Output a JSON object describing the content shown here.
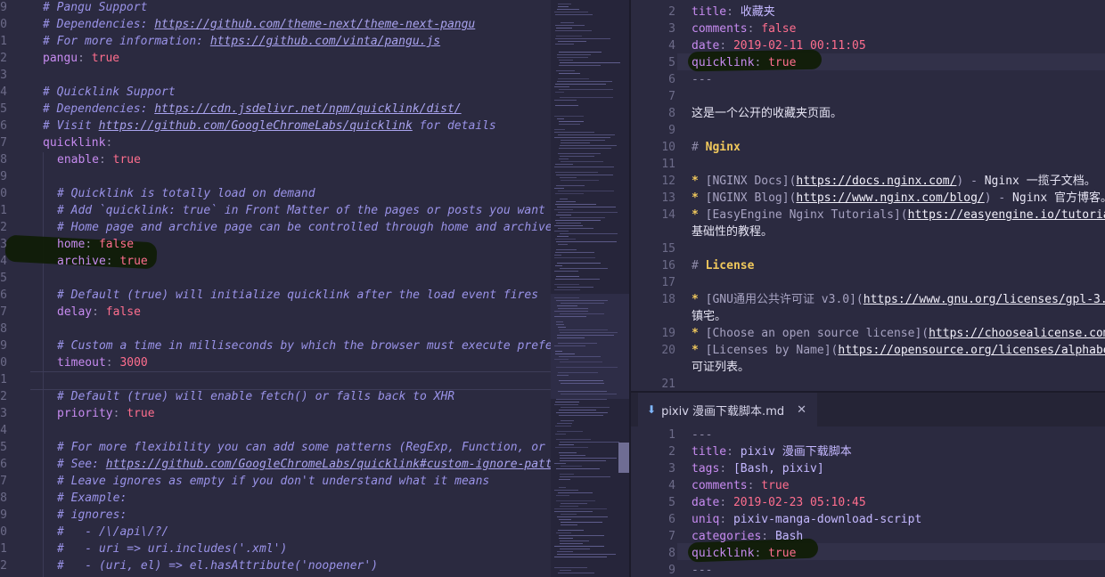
{
  "left_editor": {
    "lines": [
      {
        "num": "9",
        "indent": 0,
        "tokens": [
          {
            "t": "# Pangu Support",
            "c": "c"
          }
        ]
      },
      {
        "num": "0",
        "indent": 0,
        "tokens": [
          {
            "t": "# Dependencies: ",
            "c": "c"
          },
          {
            "t": "https://github.com/theme-next/theme-next-pangu",
            "c": "u"
          }
        ]
      },
      {
        "num": "1",
        "indent": 0,
        "tokens": [
          {
            "t": "# For more information: ",
            "c": "c"
          },
          {
            "t": "https://github.com/vinta/pangu.js",
            "c": "u"
          }
        ]
      },
      {
        "num": "2",
        "indent": 0,
        "tokens": [
          {
            "t": "pangu",
            "c": "k"
          },
          {
            "t": ": ",
            "c": "p"
          },
          {
            "t": "true",
            "c": "b"
          }
        ]
      },
      {
        "num": "3",
        "indent": 0,
        "tokens": []
      },
      {
        "num": "4",
        "indent": 0,
        "tokens": [
          {
            "t": "# Quicklink Support",
            "c": "c"
          }
        ]
      },
      {
        "num": "5",
        "indent": 0,
        "tokens": [
          {
            "t": "# Dependencies: ",
            "c": "c"
          },
          {
            "t": "https://cdn.jsdelivr.net/npm/quicklink/dist/",
            "c": "u"
          }
        ]
      },
      {
        "num": "6",
        "indent": 0,
        "tokens": [
          {
            "t": "# Visit ",
            "c": "c"
          },
          {
            "t": "https://github.com/GoogleChromeLabs/quicklink",
            "c": "u"
          },
          {
            "t": " for details",
            "c": "c"
          }
        ]
      },
      {
        "num": "7",
        "indent": 0,
        "tokens": [
          {
            "t": "quicklink",
            "c": "k"
          },
          {
            "t": ":",
            "c": "p"
          }
        ]
      },
      {
        "num": "8",
        "indent": 1,
        "tokens": [
          {
            "t": "enable",
            "c": "k"
          },
          {
            "t": ": ",
            "c": "p"
          },
          {
            "t": "true",
            "c": "b"
          }
        ]
      },
      {
        "num": "9",
        "indent": 1,
        "tokens": []
      },
      {
        "num": "0",
        "indent": 1,
        "tokens": [
          {
            "t": "# Quicklink is totally load on demand",
            "c": "c"
          }
        ]
      },
      {
        "num": "1",
        "indent": 1,
        "tokens": [
          {
            "t": "# Add `quicklink: true` in Front Matter of the pages or posts you want",
            "c": "c"
          }
        ]
      },
      {
        "num": "2",
        "indent": 1,
        "tokens": [
          {
            "t": "# Home page and archive page can be controlled through home and archive",
            "c": "c"
          }
        ]
      },
      {
        "num": "3",
        "indent": 1,
        "tokens": [
          {
            "t": "home",
            "c": "k"
          },
          {
            "t": ": ",
            "c": "p"
          },
          {
            "t": "false",
            "c": "b"
          }
        ]
      },
      {
        "num": "4",
        "indent": 1,
        "tokens": [
          {
            "t": "archive",
            "c": "k"
          },
          {
            "t": ": ",
            "c": "p"
          },
          {
            "t": "true",
            "c": "b"
          }
        ]
      },
      {
        "num": "5",
        "indent": 1,
        "tokens": []
      },
      {
        "num": "6",
        "indent": 1,
        "tokens": [
          {
            "t": "# Default (true) will initialize quicklink after the load event fires",
            "c": "c"
          }
        ]
      },
      {
        "num": "7",
        "indent": 1,
        "tokens": [
          {
            "t": "delay",
            "c": "k"
          },
          {
            "t": ": ",
            "c": "p"
          },
          {
            "t": "false",
            "c": "b"
          }
        ]
      },
      {
        "num": "8",
        "indent": 1,
        "tokens": []
      },
      {
        "num": "9",
        "indent": 1,
        "tokens": [
          {
            "t": "# Custom a time in milliseconds by which the browser must execute prefet",
            "c": "c"
          }
        ]
      },
      {
        "num": "0",
        "indent": 1,
        "tokens": [
          {
            "t": "timeout",
            "c": "k"
          },
          {
            "t": ": ",
            "c": "p"
          },
          {
            "t": "3000",
            "c": "n"
          }
        ]
      },
      {
        "num": "1",
        "indent": 1,
        "tokens": []
      },
      {
        "num": "2",
        "indent": 1,
        "tokens": [
          {
            "t": "# Default (true) will enable fetch() or falls back to XHR",
            "c": "c"
          }
        ]
      },
      {
        "num": "3",
        "indent": 1,
        "tokens": [
          {
            "t": "priority",
            "c": "k"
          },
          {
            "t": ": ",
            "c": "p"
          },
          {
            "t": "true",
            "c": "b"
          }
        ]
      },
      {
        "num": "4",
        "indent": 1,
        "tokens": []
      },
      {
        "num": "5",
        "indent": 1,
        "tokens": [
          {
            "t": "# For more flexibility you can add some patterns (RegExp, Function, or A",
            "c": "c"
          }
        ]
      },
      {
        "num": "6",
        "indent": 1,
        "tokens": [
          {
            "t": "# See: ",
            "c": "c"
          },
          {
            "t": "https://github.com/GoogleChromeLabs/quicklink#custom-ignore-patte",
            "c": "u"
          }
        ]
      },
      {
        "num": "7",
        "indent": 1,
        "tokens": [
          {
            "t": "# Leave ignores as empty if you don't understand what it means",
            "c": "c"
          }
        ]
      },
      {
        "num": "8",
        "indent": 1,
        "tokens": [
          {
            "t": "# Example:",
            "c": "c"
          }
        ]
      },
      {
        "num": "9",
        "indent": 1,
        "tokens": [
          {
            "t": "# ignores:",
            "c": "c"
          }
        ]
      },
      {
        "num": "0",
        "indent": 1,
        "tokens": [
          {
            "t": "#   - /\\/api\\/?/",
            "c": "c"
          }
        ]
      },
      {
        "num": "1",
        "indent": 1,
        "tokens": [
          {
            "t": "#   - uri => uri.includes('.xml')",
            "c": "c"
          }
        ]
      },
      {
        "num": "2",
        "indent": 1,
        "tokens": [
          {
            "t": "#   - (uri, el) => el.hasAttribute('noopener')",
            "c": "c"
          }
        ]
      }
    ]
  },
  "right_top_editor": {
    "lines": [
      {
        "num": "2",
        "tokens": [
          {
            "t": "title",
            "c": "k"
          },
          {
            "t": ": ",
            "c": "p"
          },
          {
            "t": "收藏夹",
            "c": "s"
          }
        ]
      },
      {
        "num": "3",
        "tokens": [
          {
            "t": "comments",
            "c": "k"
          },
          {
            "t": ": ",
            "c": "p"
          },
          {
            "t": "false",
            "c": "b"
          }
        ]
      },
      {
        "num": "4",
        "tokens": [
          {
            "t": "date",
            "c": "k"
          },
          {
            "t": ": ",
            "c": "p"
          },
          {
            "t": "2019-02-11 00:11:05",
            "c": "n"
          }
        ]
      },
      {
        "num": "5",
        "tokens": [
          {
            "t": "quicklink",
            "c": "k"
          },
          {
            "t": ": ",
            "c": "p"
          },
          {
            "t": "true",
            "c": "b"
          }
        ]
      },
      {
        "num": "6",
        "tokens": [
          {
            "t": "---",
            "c": "p"
          }
        ]
      },
      {
        "num": "7",
        "tokens": []
      },
      {
        "num": "8",
        "tokens": [
          {
            "t": "这是一个公开的收藏夹页面。",
            "c": "t"
          }
        ]
      },
      {
        "num": "9",
        "tokens": []
      },
      {
        "num": "10",
        "tokens": [
          {
            "t": "# ",
            "c": "p"
          },
          {
            "t": "Nginx",
            "c": "h"
          }
        ]
      },
      {
        "num": "11",
        "tokens": []
      },
      {
        "num": "12",
        "tokens": [
          {
            "t": "* ",
            "c": "h"
          },
          {
            "t": "[NGINX Docs](",
            "c": "d"
          },
          {
            "t": "https://docs.nginx.com/",
            "c": "lk"
          },
          {
            "t": ") - ",
            "c": "d"
          },
          {
            "t": "Nginx 一揽子文档。",
            "c": "t"
          }
        ]
      },
      {
        "num": "13",
        "tokens": [
          {
            "t": "* ",
            "c": "h"
          },
          {
            "t": "[NGINX Blog](",
            "c": "d"
          },
          {
            "t": "https://www.nginx.com/blog/",
            "c": "lk"
          },
          {
            "t": ") - ",
            "c": "d"
          },
          {
            "t": "Nginx 官方博客。",
            "c": "t"
          }
        ]
      },
      {
        "num": "14",
        "tokens": [
          {
            "t": "* ",
            "c": "h"
          },
          {
            "t": "[EasyEngine Nginx Tutorials](",
            "c": "d"
          },
          {
            "t": "https://easyengine.io/tutoria",
            "c": "lk"
          }
        ]
      },
      {
        "num": "",
        "tokens": [
          {
            "t": "基础性的教程。",
            "c": "t"
          }
        ]
      },
      {
        "num": "15",
        "tokens": []
      },
      {
        "num": "16",
        "tokens": [
          {
            "t": "# ",
            "c": "p"
          },
          {
            "t": "License",
            "c": "h"
          }
        ]
      },
      {
        "num": "17",
        "tokens": []
      },
      {
        "num": "18",
        "tokens": [
          {
            "t": "* ",
            "c": "h"
          },
          {
            "t": "[GNU通用公共许可证 v3.0](",
            "c": "d"
          },
          {
            "t": "https://www.gnu.org/licenses/gpl-3.",
            "c": "lk"
          }
        ]
      },
      {
        "num": "",
        "tokens": [
          {
            "t": "镇宅。",
            "c": "t"
          }
        ]
      },
      {
        "num": "19",
        "tokens": [
          {
            "t": "* ",
            "c": "h"
          },
          {
            "t": "[Choose an open source license](",
            "c": "d"
          },
          {
            "t": "https://choosealicense.com",
            "c": "lk"
          }
        ]
      },
      {
        "num": "20",
        "tokens": [
          {
            "t": "* ",
            "c": "h"
          },
          {
            "t": "[Licenses by Name](",
            "c": "d"
          },
          {
            "t": "https://opensource.org/licenses/alphabe",
            "c": "lk"
          }
        ]
      },
      {
        "num": "",
        "tokens": [
          {
            "t": "可证列表。",
            "c": "t"
          }
        ]
      },
      {
        "num": "21",
        "tokens": []
      }
    ]
  },
  "tab": {
    "label": "pixiv 漫画下载脚本.md",
    "icon": "arrow-down-icon",
    "close": "✕"
  },
  "right_bottom_editor": {
    "lines": [
      {
        "num": "1",
        "tokens": [
          {
            "t": "---",
            "c": "p"
          }
        ]
      },
      {
        "num": "2",
        "tokens": [
          {
            "t": "title",
            "c": "k"
          },
          {
            "t": ": ",
            "c": "p"
          },
          {
            "t": "pixiv 漫画下载脚本",
            "c": "s"
          }
        ]
      },
      {
        "num": "3",
        "tokens": [
          {
            "t": "tags",
            "c": "k"
          },
          {
            "t": ": ",
            "c": "p"
          },
          {
            "t": "[Bash, pixiv]",
            "c": "s"
          }
        ]
      },
      {
        "num": "4",
        "tokens": [
          {
            "t": "comments",
            "c": "k"
          },
          {
            "t": ": ",
            "c": "p"
          },
          {
            "t": "true",
            "c": "b"
          }
        ]
      },
      {
        "num": "5",
        "tokens": [
          {
            "t": "date",
            "c": "k"
          },
          {
            "t": ": ",
            "c": "p"
          },
          {
            "t": "2019-02-23 05:10:45",
            "c": "n"
          }
        ]
      },
      {
        "num": "6",
        "tokens": [
          {
            "t": "uniq",
            "c": "k"
          },
          {
            "t": ": ",
            "c": "p"
          },
          {
            "t": "pixiv-manga-download-script",
            "c": "s"
          }
        ]
      },
      {
        "num": "7",
        "tokens": [
          {
            "t": "categories",
            "c": "k"
          },
          {
            "t": ": ",
            "c": "p"
          },
          {
            "t": "Bash",
            "c": "s"
          }
        ]
      },
      {
        "num": "8",
        "tokens": [
          {
            "t": "quicklink",
            "c": "k"
          },
          {
            "t": ": ",
            "c": "p"
          },
          {
            "t": "true",
            "c": "b"
          }
        ]
      },
      {
        "num": "9",
        "tokens": [
          {
            "t": "---",
            "c": "p"
          }
        ]
      }
    ]
  },
  "colors": {
    "background": "#2b2a40",
    "comment": "#9a93e8",
    "key": "#c78bf0",
    "boolean": "#ff6e8e",
    "heading": "#f0c85c",
    "highlight_mark": "#0f1c05"
  }
}
